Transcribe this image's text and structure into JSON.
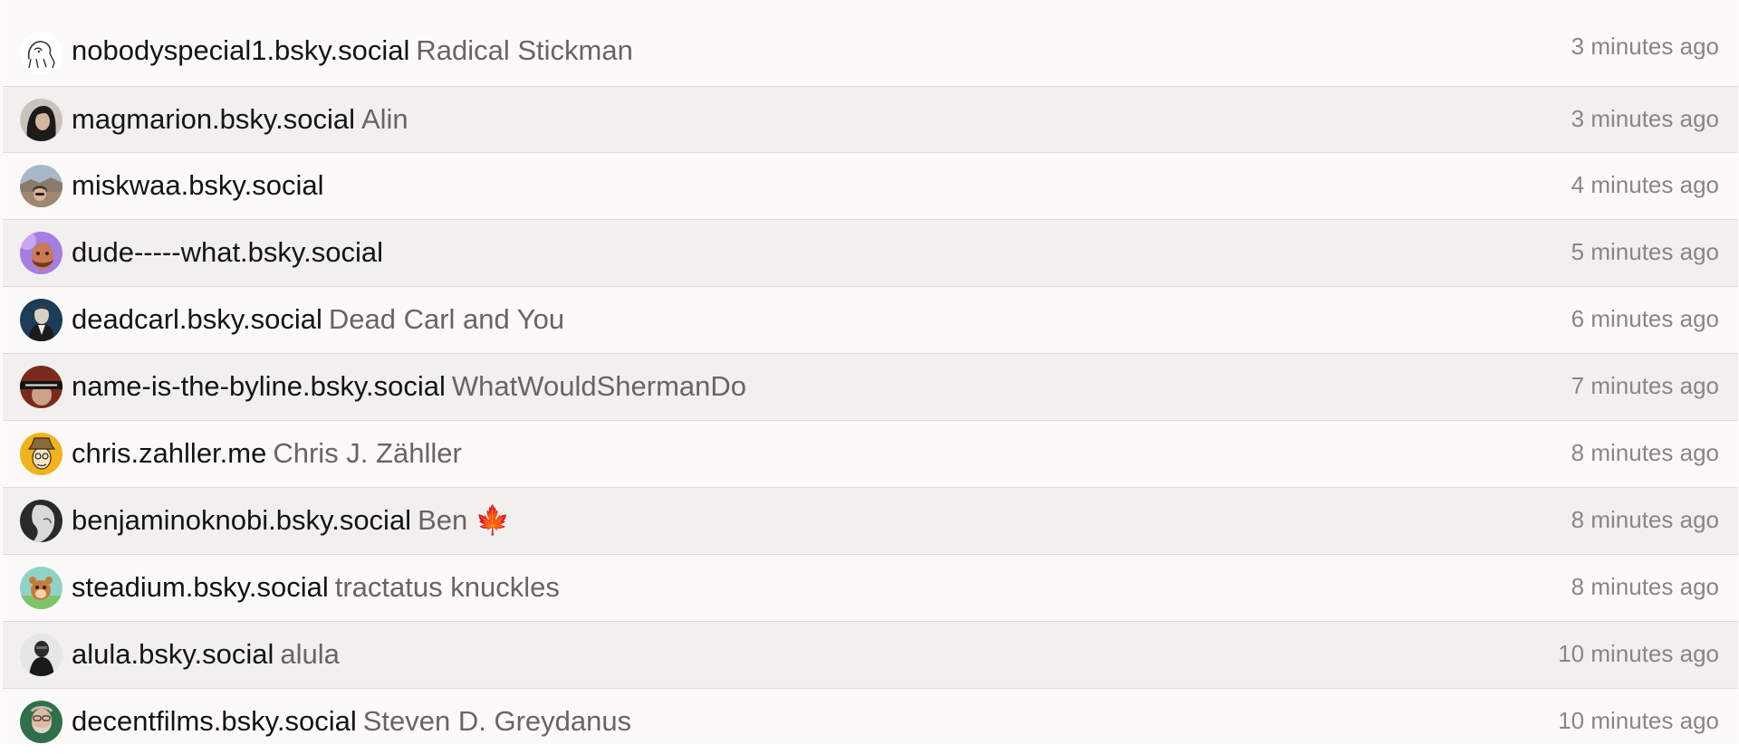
{
  "follows": [
    {
      "handle": "nobodyspecial1.bsky.social",
      "display_name": "Radical Stickman",
      "time": "3 minutes ago",
      "avatar_icon": "stickman-sketch-avatar"
    },
    {
      "handle": "magmarion.bsky.social",
      "display_name": "Alin",
      "time": "3 minutes ago",
      "avatar_icon": "woman-portrait-avatar"
    },
    {
      "handle": "miskwaa.bsky.social",
      "display_name": "",
      "time": "4 minutes ago",
      "avatar_icon": "landscape-selfie-avatar"
    },
    {
      "handle": "dude-----what.bsky.social",
      "display_name": "",
      "time": "5 minutes ago",
      "avatar_icon": "purple-portrait-avatar"
    },
    {
      "handle": "deadcarl.bsky.social",
      "display_name": "Dead Carl and You",
      "time": "6 minutes ago",
      "avatar_icon": "historical-portrait-avatar"
    },
    {
      "handle": "name-is-the-byline.bsky.social",
      "display_name": "WhatWouldShermanDo",
      "time": "7 minutes ago",
      "avatar_icon": "identity-withheld-avatar"
    },
    {
      "handle": "chris.zahller.me",
      "display_name": "Chris J. Zähller",
      "time": "8 minutes ago",
      "avatar_icon": "cartoon-hat-avatar"
    },
    {
      "handle": "benjaminoknobi.bsky.social",
      "display_name": "Ben 🍁",
      "time": "8 minutes ago",
      "avatar_icon": "bw-profile-avatar"
    },
    {
      "handle": "steadium.bsky.social",
      "display_name": "tractatus knuckles",
      "time": "8 minutes ago",
      "avatar_icon": "cartoon-animal-avatar"
    },
    {
      "handle": "alula.bsky.social",
      "display_name": "alula",
      "time": "10 minutes ago",
      "avatar_icon": "bw-figure-avatar"
    },
    {
      "handle": "decentfilms.bsky.social",
      "display_name": "Steven D. Greydanus",
      "time": "10 minutes ago",
      "avatar_icon": "bearded-man-avatar"
    }
  ]
}
